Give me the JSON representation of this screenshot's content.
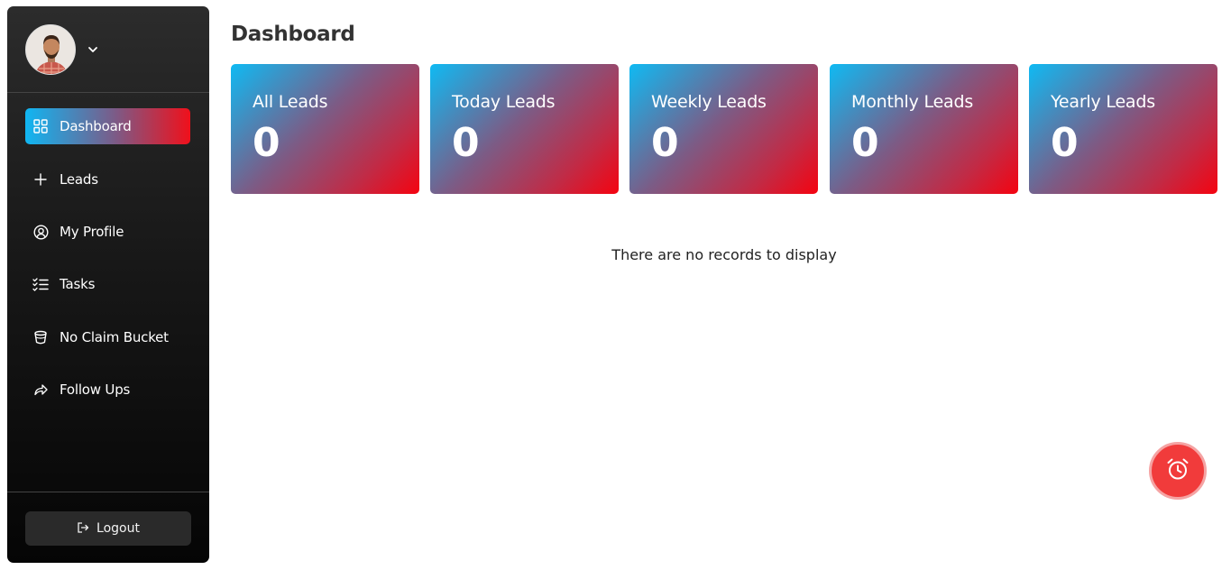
{
  "sidebar": {
    "user": {
      "avatar_icon": "user-avatar"
    },
    "items": [
      {
        "label": "Dashboard",
        "icon": "grid-icon",
        "active": true
      },
      {
        "label": "Leads",
        "icon": "plus-icon"
      },
      {
        "label": "My Profile",
        "icon": "user-circle-icon"
      },
      {
        "label": "Tasks",
        "icon": "checklist-icon"
      },
      {
        "label": "No Claim Bucket",
        "icon": "bucket-icon"
      },
      {
        "label": "Follow Ups",
        "icon": "forward-arrow-icon"
      }
    ],
    "logout_label": "Logout"
  },
  "main": {
    "title": "Dashboard",
    "cards": [
      {
        "title": "All Leads",
        "value": "0"
      },
      {
        "title": "Today Leads",
        "value": "0"
      },
      {
        "title": "Weekly Leads",
        "value": "0"
      },
      {
        "title": "Monthly Leads",
        "value": "0"
      },
      {
        "title": "Yearly Leads",
        "value": "0"
      }
    ],
    "empty_message": "There are no records to display"
  },
  "fab": {
    "icon": "alarm-clock-icon"
  },
  "colors": {
    "card_gradient_start": "#0fbaf3",
    "card_gradient_end": "#f50310",
    "fab": "#f13b3b",
    "sidebar_bg": "#1a1a1a"
  }
}
